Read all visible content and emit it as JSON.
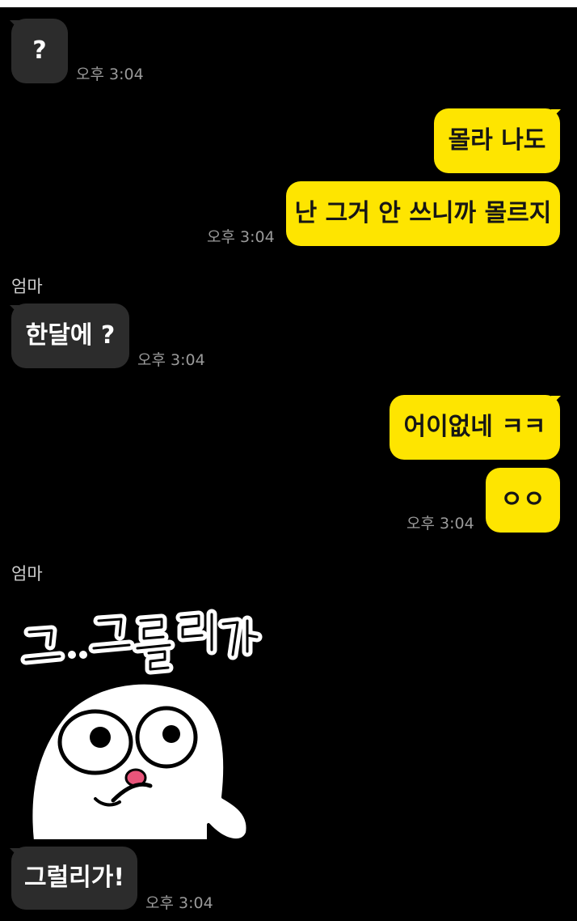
{
  "messages": {
    "m1": {
      "text": "?",
      "time": "오후 3:04"
    },
    "m2": {
      "text": "몰라 나도"
    },
    "m3": {
      "text": "난 그거 안 쓰니까 몰르지",
      "time": "오후 3:04"
    },
    "m4": {
      "sender": "엄마",
      "text": "한달에 ?",
      "time": "오후 3:04"
    },
    "m5": {
      "text": "어이없네 ㅋㅋ"
    },
    "m6": {
      "text": "ㅇㅇ",
      "time": "오후 3:04"
    },
    "m7": {
      "sender": "엄마",
      "sticker_text": "그..그럴리가"
    },
    "m8": {
      "text": "그럴리가!",
      "time": "오후 3:04"
    }
  },
  "colors": {
    "background": "#000000",
    "incoming_bubble": "#2c2c2c",
    "outgoing_bubble": "#fee500",
    "timestamp": "#9a9a9a"
  },
  "icons": {
    "sticker": "surprised-ghost-sticker"
  }
}
